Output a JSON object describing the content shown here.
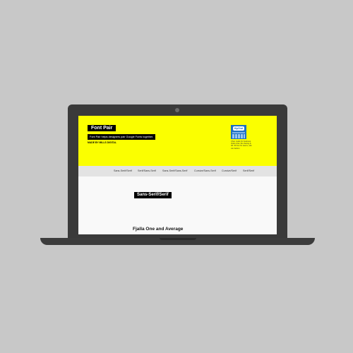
{
  "site": {
    "logo": "Font Pair",
    "tagline": "Font Pair helps designers pair Google Fonts together.",
    "credit": "MADE BY MILLS DIGITAL"
  },
  "ad": {
    "logo": "HipChat",
    "text": "Chat, made for business. Video chat, file sharing & IM. 30 free for teams, ads via Carbon"
  },
  "nav": {
    "items": [
      "Sans-Serif/Serif",
      "Serif/Sans-Serif",
      "Sans-Serif/Sans-Serif",
      "Cursive/Sans-Serif",
      "Cursive/Serif",
      "Serif/Serif"
    ]
  },
  "section": {
    "label": "Sans-Serif/Serif",
    "pair_title": "Fjalla One and Average"
  }
}
